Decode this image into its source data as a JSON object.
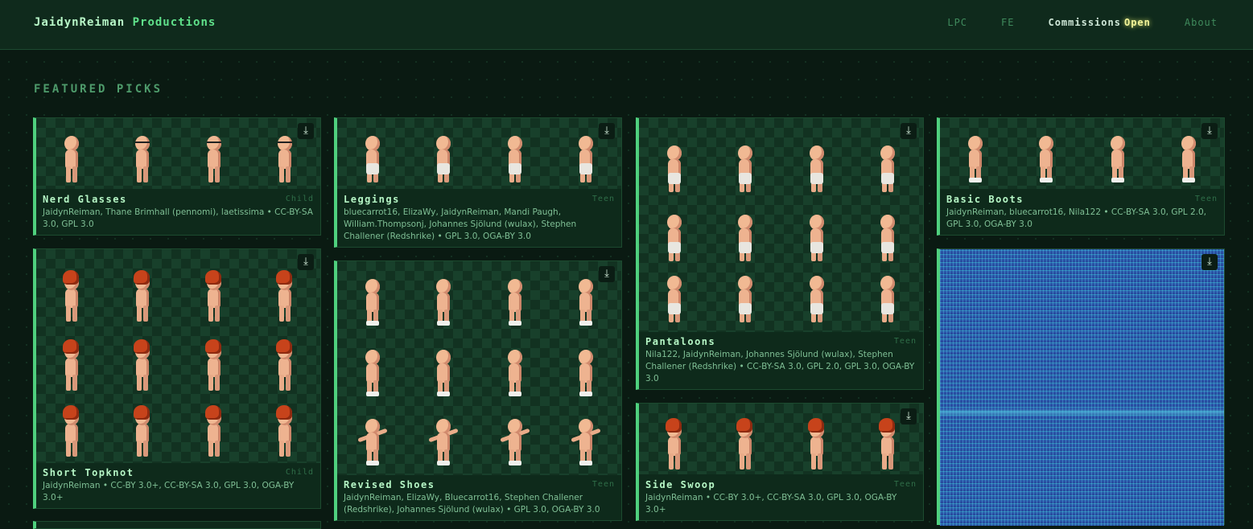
{
  "header": {
    "brand_primary": "JaidynReiman",
    "brand_secondary": "Productions",
    "nav": [
      {
        "label": "LPC"
      },
      {
        "label": "FE"
      },
      {
        "label": "Commissions",
        "badge": "Open"
      },
      {
        "label": "About"
      }
    ]
  },
  "section_title": "FEATURED PICKS",
  "download_icon": "download-icon",
  "cards": [
    {
      "title": "Nerd Glasses",
      "tag": "Child",
      "credits": "JaidynReiman, Thane Brimhall (pennomi), laetissima • CC-BY-SA 3.0, GPL 3.0"
    },
    {
      "title": "Short Topknot",
      "tag": "Child",
      "credits": "JaidynReiman • CC-BY 3.0+, CC-BY-SA 3.0, GPL 3.0, OGA-BY 3.0+"
    },
    {
      "title": "Leggings",
      "tag": "Teen",
      "credits": "bluecarrot16, ElizaWy, JaidynReiman, Mandi Paugh, William.Thompsonj, Johannes Sjölund (wulax), Stephen Challener (Redshrike) • GPL 3.0, OGA-BY 3.0"
    },
    {
      "title": "Revised Shoes",
      "tag": "Teen",
      "credits": "JaidynReiman, ElizaWy, Bluecarrot16, Stephen Challener (Redshrike), Johannes Sjölund (wulax) • GPL 3.0, OGA-BY 3.0"
    },
    {
      "title": "Pantaloons",
      "tag": "Teen",
      "credits": "Nila122, JaidynReiman, Johannes Sjölund (wulax), Stephen Challener (Redshrike) • CC-BY-SA 3.0, GPL 2.0, GPL 3.0, OGA-BY 3.0"
    },
    {
      "title": "Side Swoop",
      "tag": "Teen",
      "credits": "JaidynReiman • CC-BY 3.0+, CC-BY-SA 3.0, GPL 3.0, OGA-BY 3.0+"
    },
    {
      "title": "Basic Boots",
      "tag": "Teen",
      "credits": "JaidynReiman, bluecarrot16, Nila122 • CC-BY-SA 3.0, GPL 2.0, GPL 3.0, OGA-BY 3.0"
    }
  ],
  "colors": {
    "accent": "#4fd07e",
    "background": "#0a1a12",
    "card": "#0e2a1b",
    "badge": "#f3f59a"
  }
}
